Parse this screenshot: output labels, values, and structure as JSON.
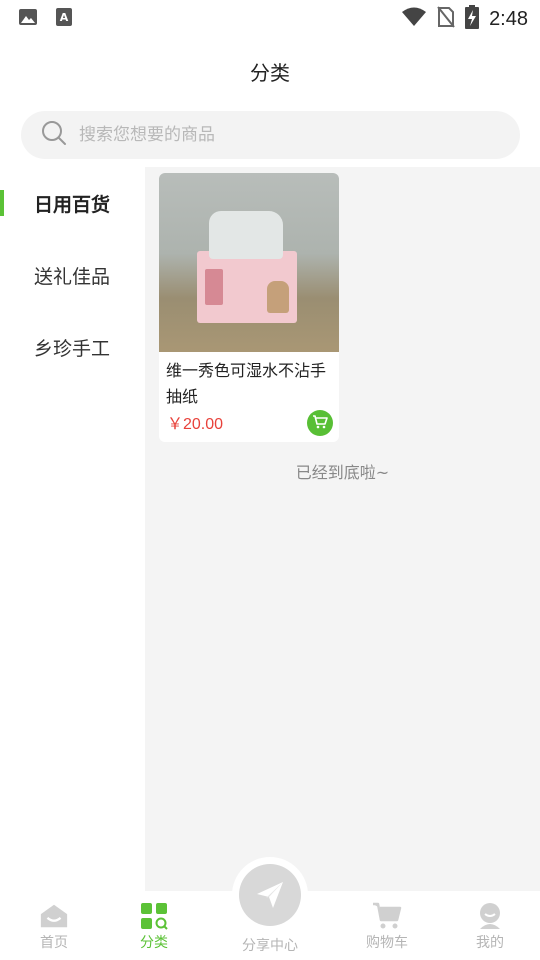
{
  "status_bar": {
    "time": "2:48",
    "icons": [
      "image-icon",
      "text-a-icon",
      "wifi-icon",
      "no-sim-icon",
      "battery-charging-icon"
    ]
  },
  "header": {
    "title": "分类"
  },
  "search": {
    "placeholder": "搜索您想要的商品",
    "value": ""
  },
  "sidebar": {
    "items": [
      {
        "label": "日用百货",
        "active": true
      },
      {
        "label": "送礼佳品",
        "active": false
      },
      {
        "label": "乡珍手工",
        "active": false
      }
    ]
  },
  "products": [
    {
      "name": "维一秀色可湿水不沾手抽纸",
      "price": "￥20.00"
    }
  ],
  "list_end_text": "已经到底啦~",
  "tabbar": {
    "tabs": [
      {
        "label": "首页",
        "icon": "home-icon",
        "active": false
      },
      {
        "label": "分类",
        "icon": "category-icon",
        "active": true
      },
      {
        "label": "分享中心",
        "icon": "share-send-icon",
        "active": false
      },
      {
        "label": "购物车",
        "icon": "cart-icon",
        "active": false
      },
      {
        "label": "我的",
        "icon": "profile-icon",
        "active": false
      }
    ]
  },
  "colors": {
    "accent": "#5bc236",
    "price": "#e8413a",
    "inactive": "#b5b5b5"
  }
}
